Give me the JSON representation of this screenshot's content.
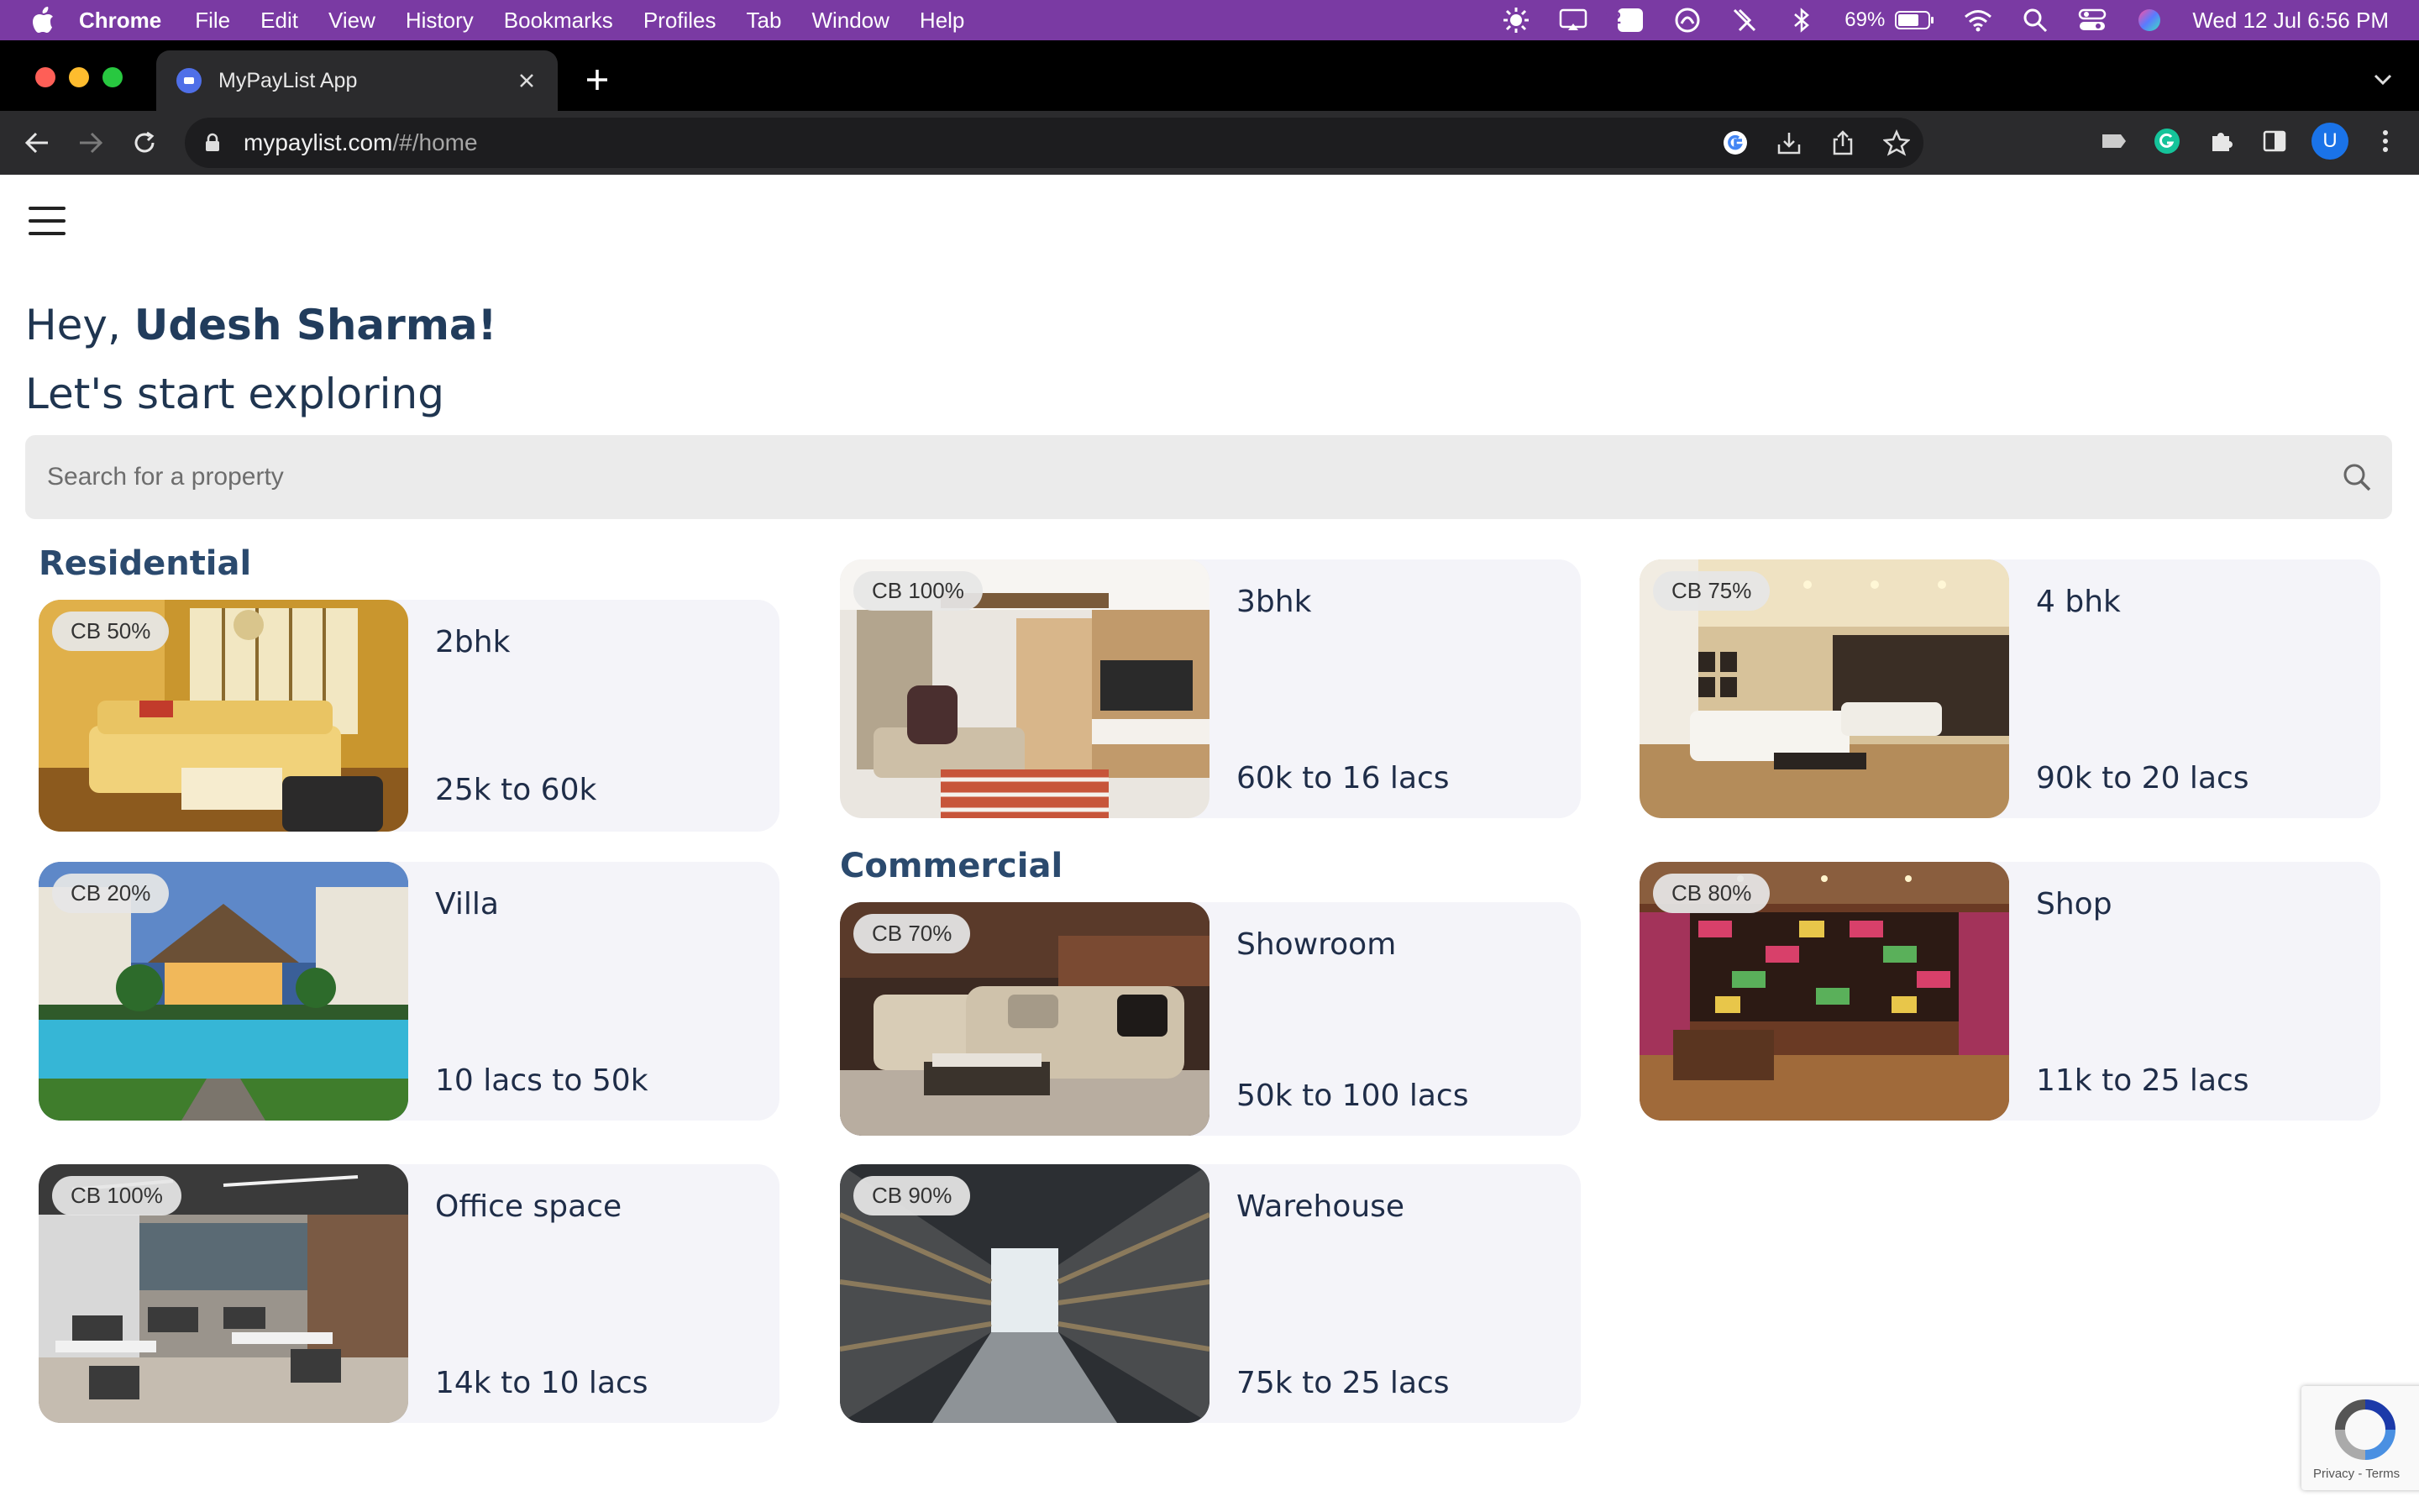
{
  "menubar": {
    "app_name": "Chrome",
    "items": [
      "File",
      "Edit",
      "View",
      "History",
      "Bookmarks",
      "Profiles",
      "Tab",
      "Window",
      "Help"
    ],
    "calendar_badge": "12",
    "battery_percent": "69%",
    "datetime": "Wed 12 Jul  6:56 PM",
    "bg_color": "#7a3aa3"
  },
  "browser": {
    "tab_title": "MyPayList App",
    "url_host": "mypaylist.com",
    "url_path": "/#/home",
    "profile_initial": "U"
  },
  "page": {
    "greeting_prefix": "Hey, ",
    "user_name": "Udesh Sharma!",
    "subheading": "Let's start exploring",
    "search_placeholder": "Search for a property",
    "sections": {
      "residential": "Residential",
      "commercial": "Commercial"
    },
    "cards": [
      {
        "title": "2bhk",
        "price": "25k to 60k",
        "badge": "CB 50%",
        "image": "living-room-photo"
      },
      {
        "title": "3bhk",
        "price": "60k to 16 lacs",
        "badge": "CB 100%",
        "image": "living-room-photo"
      },
      {
        "title": "4 bhk",
        "price": "90k to 20 lacs",
        "badge": "CB 75%",
        "image": "hall-photo"
      },
      {
        "title": "Villa",
        "price": "10 lacs to 50k",
        "badge": "CB 20%",
        "image": "villa-pool-photo"
      },
      {
        "title": "Showroom",
        "price": "50k to 100 lacs",
        "badge": "CB 70%",
        "image": "showroom-sofa-photo"
      },
      {
        "title": "Shop",
        "price": "11k to 25 lacs",
        "badge": "CB 80%",
        "image": "shop-interior-photo"
      },
      {
        "title": "Office space",
        "price": "14k to 10 lacs",
        "badge": "CB 100%",
        "image": "office-photo"
      },
      {
        "title": "Warehouse",
        "price": "75k to 25 lacs",
        "badge": "CB 90%",
        "image": "warehouse-photo"
      }
    ],
    "recaptcha_text": "Privacy - Terms"
  },
  "colors": {
    "heading": "#213c5c",
    "section": "#2b4a6e",
    "card_bg": "#f4f4f9"
  }
}
